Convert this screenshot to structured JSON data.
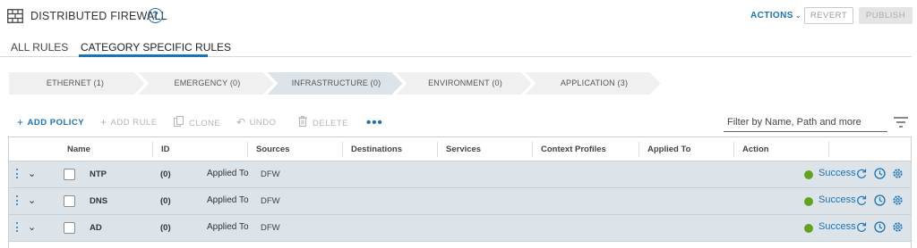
{
  "header": {
    "title": "DISTRIBUTED FIREWALL",
    "help_icon": "?",
    "actions_label": "ACTIONS",
    "revert_label": "REVERT",
    "publish_label": "PUBLISH"
  },
  "tabs": [
    {
      "label": "ALL RULES",
      "active": false
    },
    {
      "label": "CATEGORY SPECIFIC RULES",
      "active": true
    }
  ],
  "categories": [
    {
      "label": "ETHERNET (1)",
      "active": false
    },
    {
      "label": "EMERGENCY (0)",
      "active": false
    },
    {
      "label": "INFRASTRUCTURE (0)",
      "active": true
    },
    {
      "label": "ENVIRONMENT (0)",
      "active": false
    },
    {
      "label": "APPLICATION (3)",
      "active": false
    }
  ],
  "toolbar": {
    "add_policy": "ADD POLICY",
    "add_rule": "ADD RULE",
    "clone": "CLONE",
    "undo": "UNDO",
    "delete": "DELETE",
    "more": "•••",
    "filter_placeholder": "Filter by Name, Path and more"
  },
  "table": {
    "columns": [
      "Name",
      "ID",
      "Sources",
      "Destinations",
      "Services",
      "Context Profiles",
      "Applied To",
      "Action"
    ],
    "rows": [
      {
        "name": "NTP",
        "id": "(0)",
        "applied_to": "Applied To",
        "sources": "DFW",
        "status": "Success"
      },
      {
        "name": "DNS",
        "id": "(0)",
        "applied_to": "Applied To",
        "sources": "DFW",
        "status": "Success"
      },
      {
        "name": "AD",
        "id": "(0)",
        "applied_to": "Applied To",
        "sources": "DFW",
        "status": "Success"
      }
    ]
  },
  "colors": {
    "accent": "#1a72b8",
    "chevron_bg": "#f0f0f0",
    "chevron_active_bg": "#dce4ea",
    "row_bg": "#dce4ea",
    "success": "#62a420"
  },
  "icons": [
    "firewall-icon",
    "help-icon",
    "chevron-down-icon",
    "plus-icon",
    "clone-icon",
    "undo-icon",
    "delete-icon",
    "more-icon",
    "filter-icon",
    "drag-handle-icon",
    "expand-chevron-icon",
    "refresh-icon",
    "stats-icon",
    "gear-icon"
  ]
}
